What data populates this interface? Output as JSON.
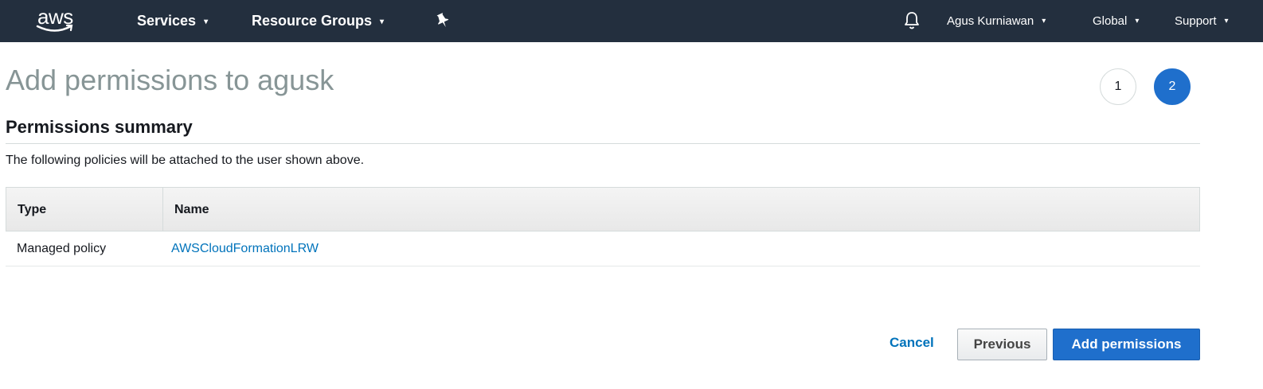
{
  "navbar": {
    "logo_text": "aws",
    "services_label": "Services",
    "resource_groups_label": "Resource Groups",
    "pin_icon": "pin-icon",
    "bell_icon": "bell-icon",
    "user_label": "Agus Kurniawan",
    "region_label": "Global",
    "support_label": "Support",
    "caret_glyph": "▾"
  },
  "page": {
    "title": "Add permissions to agusk",
    "steps": [
      "1",
      "2"
    ],
    "active_step": "2"
  },
  "summary": {
    "title": "Permissions summary",
    "description": "The following policies will be attached to the user shown above."
  },
  "table": {
    "columns": [
      "Type",
      "Name"
    ],
    "rows": [
      {
        "type": "Managed policy",
        "name": "AWSCloudFormationLRW"
      }
    ]
  },
  "actions": {
    "cancel_label": "Cancel",
    "previous_label": "Previous",
    "add_label": "Add permissions"
  },
  "colors": {
    "navbar_bg": "#232f3e",
    "primary_blue": "#1f6fcc",
    "link_blue": "#0073bb",
    "title_gray": "#879596"
  }
}
